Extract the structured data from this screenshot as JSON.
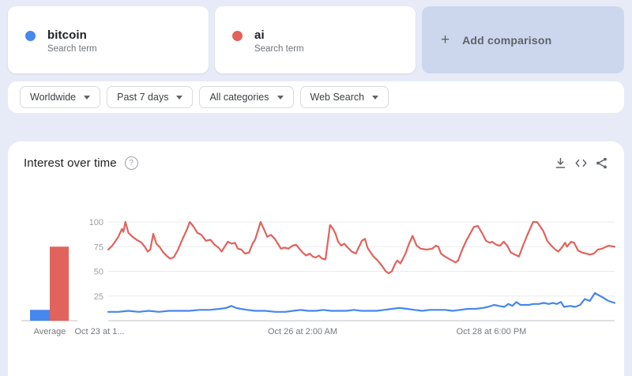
{
  "comparison_cards": [
    {
      "term": "bitcoin",
      "subtitle": "Search term",
      "color": "#4787ee"
    },
    {
      "term": "ai",
      "subtitle": "Search term",
      "color": "#e0635c"
    }
  ],
  "add_comparison": {
    "plus": "+",
    "label": "Add comparison"
  },
  "filters": [
    {
      "label": "Worldwide"
    },
    {
      "label": "Past 7 days"
    },
    {
      "label": "All categories"
    },
    {
      "label": "Web Search"
    }
  ],
  "chart_section": {
    "title": "Interest over time",
    "help_glyph": "?",
    "icons": [
      "download-icon",
      "embed-icon",
      "share-icon"
    ]
  },
  "chart_data": {
    "type": "line",
    "title": "Interest over time",
    "ylim": [
      0,
      100
    ],
    "yticks": [
      25,
      50,
      75,
      100
    ],
    "grid": true,
    "xticks": [
      "Oct 23 at 1...",
      "Oct 26 at 2:00 AM",
      "Oct 28 at 6:00 PM"
    ],
    "average_label": "Average",
    "average": [
      {
        "name": "bitcoin",
        "value": 11,
        "color": "#4787ee"
      },
      {
        "name": "ai",
        "value": 75,
        "color": "#e0635c"
      }
    ],
    "series": [
      {
        "name": "ai",
        "color": "#e0635c",
        "points": [
          [
            0.0,
            72
          ],
          [
            0.008,
            76
          ],
          [
            0.016,
            82
          ],
          [
            0.02,
            85
          ],
          [
            0.027,
            93
          ],
          [
            0.03,
            90
          ],
          [
            0.034,
            100
          ],
          [
            0.04,
            89
          ],
          [
            0.048,
            85
          ],
          [
            0.056,
            82
          ],
          [
            0.066,
            79
          ],
          [
            0.072,
            75
          ],
          [
            0.078,
            70
          ],
          [
            0.083,
            72
          ],
          [
            0.089,
            88
          ],
          [
            0.095,
            78
          ],
          [
            0.101,
            75
          ],
          [
            0.109,
            69
          ],
          [
            0.117,
            65
          ],
          [
            0.122,
            63
          ],
          [
            0.129,
            64
          ],
          [
            0.137,
            71
          ],
          [
            0.147,
            83
          ],
          [
            0.155,
            92
          ],
          [
            0.161,
            100
          ],
          [
            0.169,
            95
          ],
          [
            0.176,
            89
          ],
          [
            0.184,
            87
          ],
          [
            0.193,
            81
          ],
          [
            0.202,
            82
          ],
          [
            0.21,
            77
          ],
          [
            0.218,
            74
          ],
          [
            0.224,
            70
          ],
          [
            0.23,
            75
          ],
          [
            0.236,
            80
          ],
          [
            0.244,
            78
          ],
          [
            0.25,
            79
          ],
          [
            0.256,
            73
          ],
          [
            0.263,
            72
          ],
          [
            0.27,
            68
          ],
          [
            0.278,
            69
          ],
          [
            0.285,
            78
          ],
          [
            0.29,
            82
          ],
          [
            0.301,
            100
          ],
          [
            0.309,
            91
          ],
          [
            0.314,
            85
          ],
          [
            0.321,
            87
          ],
          [
            0.329,
            83
          ],
          [
            0.335,
            78
          ],
          [
            0.341,
            73
          ],
          [
            0.348,
            74
          ],
          [
            0.356,
            73
          ],
          [
            0.364,
            76
          ],
          [
            0.371,
            77
          ],
          [
            0.384,
            69
          ],
          [
            0.391,
            66
          ],
          [
            0.398,
            68
          ],
          [
            0.404,
            65
          ],
          [
            0.41,
            64
          ],
          [
            0.416,
            66
          ],
          [
            0.422,
            63
          ],
          [
            0.429,
            62
          ],
          [
            0.438,
            97
          ],
          [
            0.444,
            93
          ],
          [
            0.449,
            88
          ],
          [
            0.454,
            80
          ],
          [
            0.46,
            76
          ],
          [
            0.466,
            78
          ],
          [
            0.473,
            74
          ],
          [
            0.481,
            70
          ],
          [
            0.489,
            68
          ],
          [
            0.501,
            81
          ],
          [
            0.507,
            83
          ],
          [
            0.512,
            74
          ],
          [
            0.517,
            70
          ],
          [
            0.524,
            65
          ],
          [
            0.532,
            61
          ],
          [
            0.54,
            56
          ],
          [
            0.548,
            50
          ],
          [
            0.554,
            48
          ],
          [
            0.56,
            50
          ],
          [
            0.567,
            58
          ],
          [
            0.571,
            61
          ],
          [
            0.577,
            58
          ],
          [
            0.587,
            68
          ],
          [
            0.594,
            78
          ],
          [
            0.601,
            86
          ],
          [
            0.609,
            76
          ],
          [
            0.617,
            73
          ],
          [
            0.629,
            72
          ],
          [
            0.64,
            73
          ],
          [
            0.647,
            76
          ],
          [
            0.652,
            75
          ],
          [
            0.657,
            68
          ],
          [
            0.665,
            65
          ],
          [
            0.672,
            63
          ],
          [
            0.686,
            59
          ],
          [
            0.691,
            61
          ],
          [
            0.699,
            72
          ],
          [
            0.707,
            81
          ],
          [
            0.722,
            95
          ],
          [
            0.73,
            96
          ],
          [
            0.738,
            89
          ],
          [
            0.746,
            81
          ],
          [
            0.753,
            79
          ],
          [
            0.758,
            80
          ],
          [
            0.766,
            77
          ],
          [
            0.774,
            76
          ],
          [
            0.781,
            80
          ],
          [
            0.788,
            76
          ],
          [
            0.795,
            69
          ],
          [
            0.803,
            67
          ],
          [
            0.811,
            65
          ],
          [
            0.819,
            76
          ],
          [
            0.827,
            86
          ],
          [
            0.839,
            100
          ],
          [
            0.847,
            100
          ],
          [
            0.859,
            91
          ],
          [
            0.867,
            81
          ],
          [
            0.875,
            76
          ],
          [
            0.883,
            72
          ],
          [
            0.889,
            70
          ],
          [
            0.897,
            75
          ],
          [
            0.902,
            79
          ],
          [
            0.906,
            75
          ],
          [
            0.914,
            80
          ],
          [
            0.92,
            79
          ],
          [
            0.928,
            71
          ],
          [
            0.936,
            69
          ],
          [
            0.944,
            68
          ],
          [
            0.951,
            67
          ],
          [
            0.959,
            68
          ],
          [
            0.967,
            72
          ],
          [
            0.975,
            73
          ],
          [
            0.988,
            76
          ],
          [
            1.0,
            75
          ]
        ]
      },
      {
        "name": "bitcoin",
        "color": "#4787ee",
        "points": [
          [
            0.0,
            9
          ],
          [
            0.02,
            9
          ],
          [
            0.04,
            10
          ],
          [
            0.06,
            9
          ],
          [
            0.08,
            10
          ],
          [
            0.1,
            9
          ],
          [
            0.12,
            10
          ],
          [
            0.14,
            10
          ],
          [
            0.16,
            10
          ],
          [
            0.18,
            11
          ],
          [
            0.2,
            11
          ],
          [
            0.22,
            12
          ],
          [
            0.233,
            13
          ],
          [
            0.243,
            15
          ],
          [
            0.252,
            13
          ],
          [
            0.262,
            12
          ],
          [
            0.275,
            11
          ],
          [
            0.29,
            10
          ],
          [
            0.31,
            10
          ],
          [
            0.33,
            9
          ],
          [
            0.35,
            9
          ],
          [
            0.365,
            10
          ],
          [
            0.38,
            11
          ],
          [
            0.395,
            10
          ],
          [
            0.41,
            10
          ],
          [
            0.425,
            11
          ],
          [
            0.44,
            10
          ],
          [
            0.455,
            10
          ],
          [
            0.47,
            10
          ],
          [
            0.485,
            11
          ],
          [
            0.5,
            10
          ],
          [
            0.515,
            10
          ],
          [
            0.53,
            10
          ],
          [
            0.545,
            11
          ],
          [
            0.56,
            12
          ],
          [
            0.575,
            13
          ],
          [
            0.59,
            12
          ],
          [
            0.605,
            11
          ],
          [
            0.62,
            10
          ],
          [
            0.635,
            11
          ],
          [
            0.65,
            11
          ],
          [
            0.665,
            11
          ],
          [
            0.68,
            10
          ],
          [
            0.695,
            11
          ],
          [
            0.71,
            12
          ],
          [
            0.725,
            12
          ],
          [
            0.74,
            13
          ],
          [
            0.75,
            14
          ],
          [
            0.762,
            16
          ],
          [
            0.772,
            15
          ],
          [
            0.782,
            14
          ],
          [
            0.79,
            17
          ],
          [
            0.798,
            15
          ],
          [
            0.806,
            19
          ],
          [
            0.814,
            16
          ],
          [
            0.822,
            16
          ],
          [
            0.83,
            16
          ],
          [
            0.84,
            17
          ],
          [
            0.85,
            17
          ],
          [
            0.86,
            18
          ],
          [
            0.87,
            17
          ],
          [
            0.878,
            18
          ],
          [
            0.886,
            17
          ],
          [
            0.894,
            19
          ],
          [
            0.9,
            14
          ],
          [
            0.912,
            15
          ],
          [
            0.922,
            14
          ],
          [
            0.932,
            16
          ],
          [
            0.941,
            22
          ],
          [
            0.951,
            20
          ],
          [
            0.961,
            28
          ],
          [
            0.975,
            24
          ],
          [
            0.988,
            20
          ],
          [
            1.0,
            18
          ]
        ]
      }
    ]
  }
}
